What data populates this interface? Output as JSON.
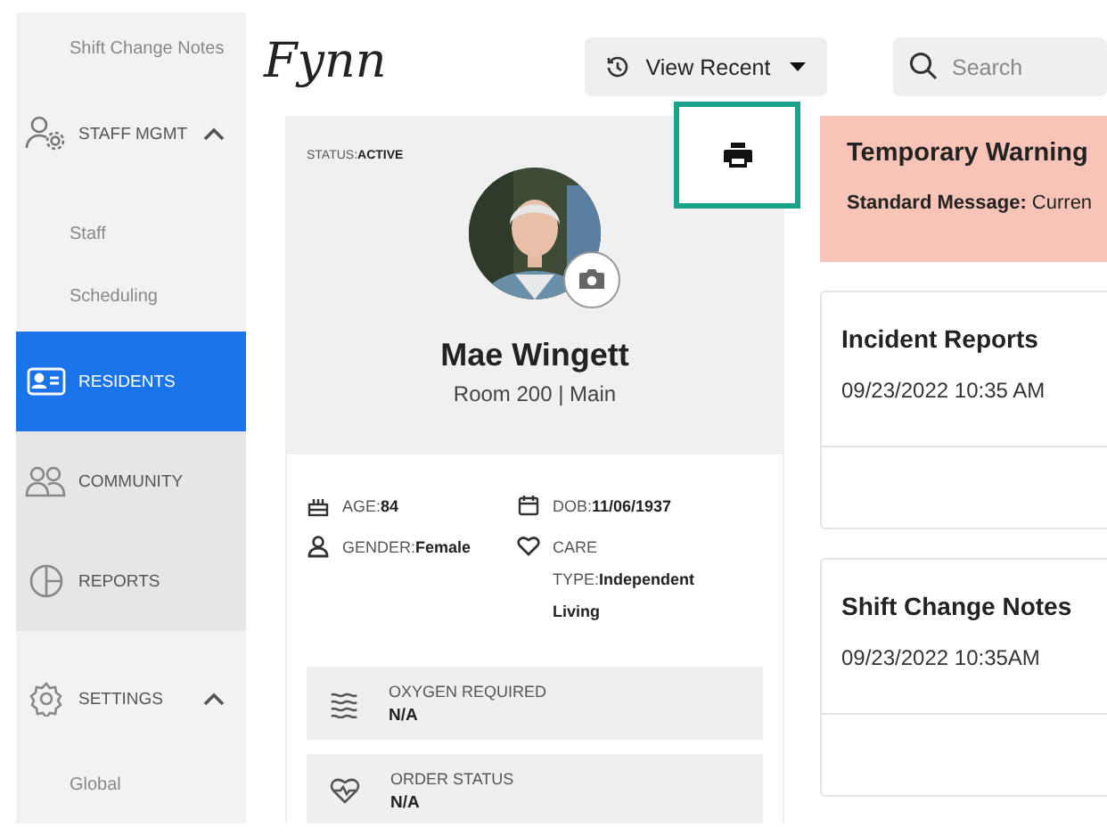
{
  "sidebar": {
    "items": [
      {
        "kind": "sub",
        "label": "Shift Change Notes",
        "selected": false
      },
      {
        "kind": "group",
        "label": "STAFF MGMT",
        "expanded": true,
        "selected": false
      },
      {
        "kind": "sub",
        "label": "Staff",
        "selected": false
      },
      {
        "kind": "sub",
        "label": "Scheduling",
        "selected": false
      },
      {
        "kind": "link",
        "label": "RESIDENTS",
        "selected": true
      },
      {
        "kind": "link",
        "label": "COMMUNITY",
        "selected": false
      },
      {
        "kind": "link",
        "label": "REPORTS",
        "selected": false
      },
      {
        "kind": "group",
        "label": "SETTINGS",
        "expanded": true,
        "selected": false
      },
      {
        "kind": "sub",
        "label": "Global",
        "selected": false
      }
    ]
  },
  "logo": "Fynn",
  "view_recent": {
    "label": "View Recent"
  },
  "search": {
    "placeholder": "Search"
  },
  "profile": {
    "status": {
      "label": "STATUS:",
      "value": "ACTIVE"
    },
    "name": "Mae Wingett",
    "location": "Room 200 | Main",
    "details": [
      {
        "label": "AGE:",
        "value": "84"
      },
      {
        "label": "DOB:",
        "value": "11/06/1937"
      },
      {
        "label": "GENDER:",
        "value": "Female"
      },
      {
        "label": "CARE TYPE:",
        "value": "Independent Living"
      }
    ],
    "info_rows": [
      {
        "label": "OXYGEN REQUIRED",
        "value": "N/A"
      },
      {
        "label": "ORDER STATUS",
        "value": "N/A"
      }
    ]
  },
  "warning": {
    "title": "Temporary Warning",
    "message": "**Standard Message:** Curren"
  },
  "cards": [
    {
      "title": "Incident Reports",
      "rows": [
        {
          "time": "09/23/2022 10:35 AM"
        }
      ]
    },
    {
      "title": "Shift Change Notes",
      "rows": [
        {
          "time": "09/23/2022 10:35AM"
        }
      ]
    }
  ]
}
